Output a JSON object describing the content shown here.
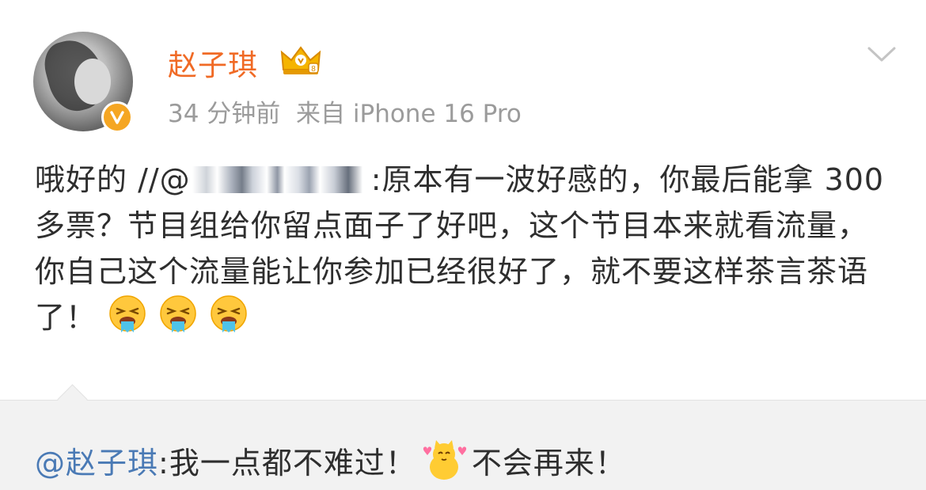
{
  "post": {
    "author": "赵子琪",
    "time": "34 分钟前",
    "source": "来自 iPhone 16 Pro",
    "content_prefix": "哦好的 //@",
    "content_body": ":原本有一波好感的，你最后能拿 300 多票？节目组给你留点面子了好吧，这个节目本来就看流量，你自己这个流量能让你参加已经很好了，就不要这样茶言茶语了！",
    "emojis": [
      "vomit-emoji",
      "vomit-emoji",
      "vomit-emoji"
    ]
  },
  "repost": {
    "mention": "@赵子琪",
    "text_before": ":我一点都不难过！",
    "text_after": "不会再来！"
  },
  "colors": {
    "name": "#f06a25",
    "meta": "#9b9b9b",
    "mention": "#4a7ab5",
    "badge": "#f5a623",
    "repost_bg": "#f2f2f2"
  }
}
